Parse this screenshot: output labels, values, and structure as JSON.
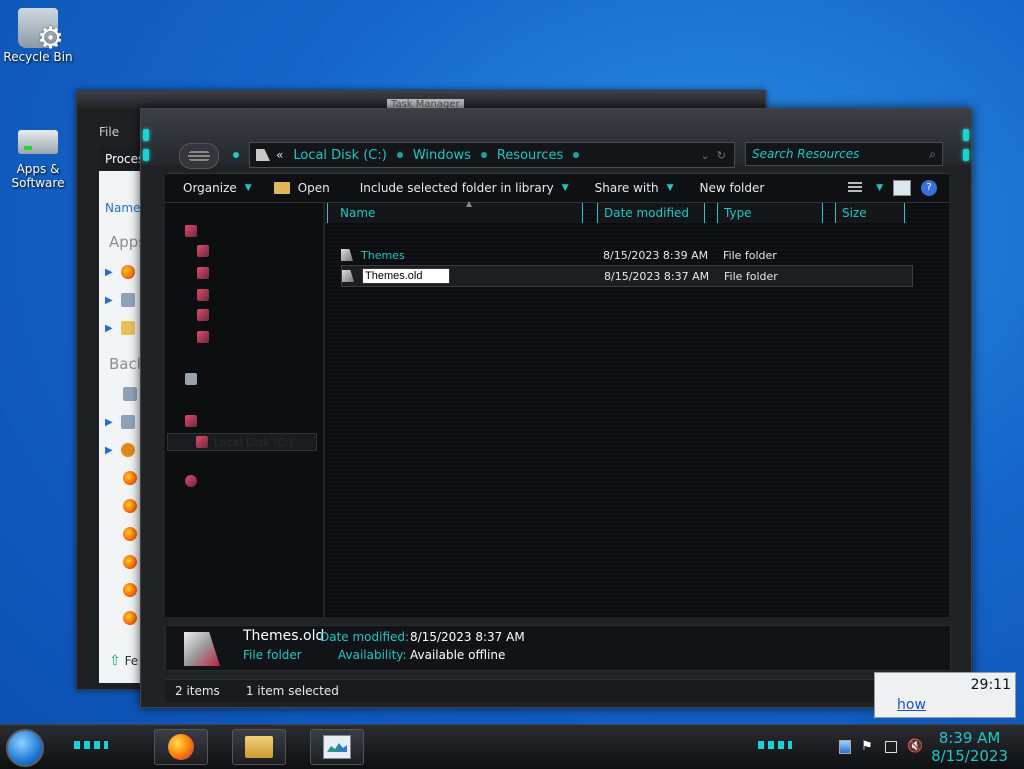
{
  "desktop": {
    "recycle_label": "Recycle Bin",
    "apps_label": "Apps & Software"
  },
  "task_manager": {
    "title": "Task Manager",
    "menu_file": "File",
    "tab_processes": "Proces",
    "col_name": "Name",
    "group_apps": "Apps",
    "group_background": "Backg",
    "fewer_details": "Fe"
  },
  "explorer": {
    "address": {
      "overflow": "«",
      "crumbs": [
        "Local Disk (C:)",
        "Windows",
        "Resources"
      ]
    },
    "search_placeholder": "Search Resources",
    "toolbar": {
      "organize": "Organize",
      "open": "Open",
      "include": "Include selected folder in library",
      "share": "Share with",
      "new_folder": "New folder",
      "help": "?"
    },
    "nav": {
      "selected": "Local Disk (C:)"
    },
    "columns": {
      "name": "Name",
      "date": "Date modified",
      "type": "Type",
      "size": "Size"
    },
    "files": [
      {
        "name": "Themes",
        "date": "8/15/2023 8:39 AM",
        "type": "File folder"
      },
      {
        "name": "Themes.old",
        "date": "8/15/2023 8:37 AM",
        "type": "File folder"
      }
    ],
    "details": {
      "name": "Themes.old",
      "type": "File folder",
      "date_label": "Date modified:",
      "date_value": "8/15/2023 8:37 AM",
      "avail_label": "Availability:",
      "avail_value": "Available offline"
    },
    "status": {
      "count": "2 items",
      "selected": "1 item selected"
    }
  },
  "toast": {
    "time": "29:11",
    "link": "how"
  },
  "taskbar": {
    "time": "8:39 AM",
    "date": "8/15/2023"
  }
}
